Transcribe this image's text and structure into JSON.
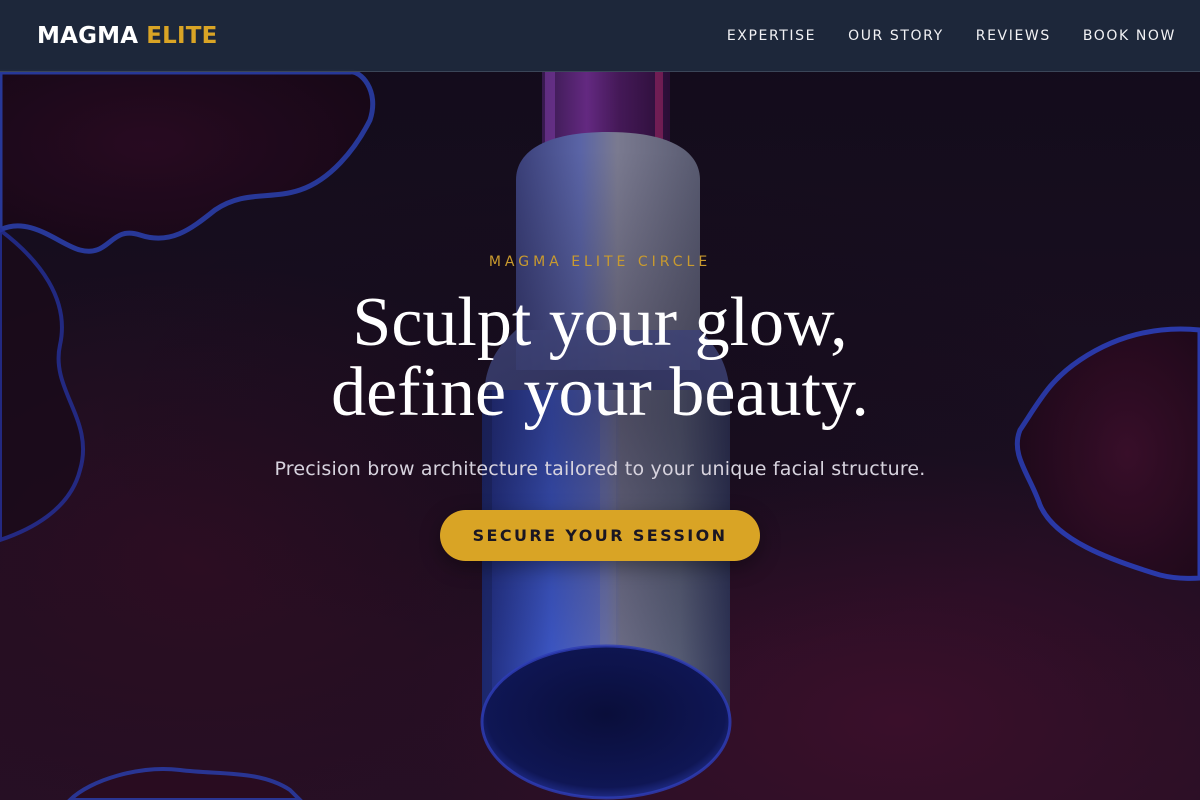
{
  "brand": {
    "part1": "MAGMA",
    "part2": "ELITE"
  },
  "nav": {
    "items": [
      {
        "label": "EXPERTISE"
      },
      {
        "label": "OUR STORY"
      },
      {
        "label": "REVIEWS"
      },
      {
        "label": "BOOK NOW"
      }
    ]
  },
  "hero": {
    "eyebrow": "MAGMA ELITE CIRCLE",
    "headline_line1": "Sculpt your glow,",
    "headline_line2": "define your beauty.",
    "subtitle": "Precision brow architecture tailored to your unique facial structure.",
    "cta_label": "SECURE YOUR SESSION"
  },
  "colors": {
    "accent": "#d9a425",
    "navbar": "#1e293b",
    "background": "#140d1c"
  }
}
